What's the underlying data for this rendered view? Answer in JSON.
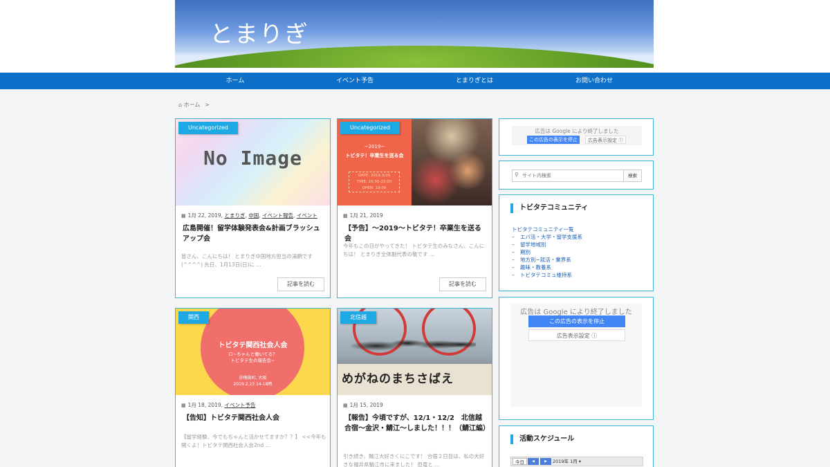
{
  "site": {
    "title": "とまりぎ"
  },
  "nav": [
    {
      "label": "ホーム"
    },
    {
      "label": "イベント予告"
    },
    {
      "label": "とまりぎとは"
    },
    {
      "label": "お問い合わせ"
    }
  ],
  "breadcrumb": {
    "home": "ホーム",
    "sep": ">"
  },
  "posts": [
    {
      "category": "Uncategorized",
      "thumb_text": "No Image",
      "date": "1月 22, 2019,",
      "tags": [
        "とまりぎ",
        "中国",
        "イベント報告",
        "イベント"
      ],
      "title": "広島開催！留学体験発表会&計画ブラッシュアップ会",
      "excerpt": "皆さん、こんにちは！ とまりぎ中国地方担当の湯網です(^^^^) 先日、1月13日(日)に …",
      "read_more": "記事を読む"
    },
    {
      "category": "Uncategorized",
      "thumb_lines": [
        "~2019~",
        "トビタテ！卒業生を送る会",
        "DATE: 2019.3/29",
        "TIME: 19:30-22:00",
        "OPEN: 19:00"
      ],
      "date": "1月 21, 2019",
      "tags": [],
      "title": "【予告】～2019～トビタテ！卒業生を送る会",
      "excerpt": "今年もこの日がやってきた！ トビタテ生のみなさん、こんにちは！ とまりぎ全体副代表の敬です …",
      "read_more": "記事を読む"
    },
    {
      "category": "関西",
      "thumb_lines": [
        "トビタテ関西社会人会",
        "ロ~ちゃんと働いてる？",
        "トビタテ生の報告会~",
        "＠梅田町, 大阪",
        "2019.2.23 14-18時"
      ],
      "date": "1月 18, 2019,",
      "tags": [
        "イベント予告"
      ],
      "title": "【告知】トビタテ関西社会人会",
      "excerpt": "【留学経験、今でもちゃんと活かせてますか？？】 <<今年も開くよ！トビタテ関西社会人会2nd …",
      "read_more": ""
    },
    {
      "category": "北信越",
      "thumb_text": "めがねのまちさばえ",
      "date": "1月 15, 2019",
      "tags": [],
      "title": "【報告】今頃ですが、12/1・12/2　北信越合宿～金沢・鯖江～しました！！！（鯖江編）",
      "excerpt": "引き続き、鯖江大好きくにこです！ 合宿２日目は、私の大好きな福井県鯖江市に来ました！ 恐竜と …",
      "read_more": ""
    }
  ],
  "sidebar": {
    "ad_small": {
      "text": "広告は Google により終了しました",
      "stop": "この広告の表示を停止",
      "settings": "広告表示設定 ⓘ"
    },
    "search": {
      "placeholder": "サイト内検索",
      "button": "検索"
    },
    "community": {
      "title": "トビタテコミュニティ",
      "root": "トビタテコミュニティ一覧",
      "items": [
        "エバ活・大学・留学支援系",
        "留学地域別",
        "期別",
        "地方別~就活・業界系",
        "趣味・教養系",
        "トビタテコミュ維持系"
      ]
    },
    "ad_big": {
      "text": "広告は Google により終了しました",
      "stop": "この広告の表示を停止",
      "settings": "広告表示設定 ⓘ"
    },
    "schedule": {
      "title": "活動スケジュール",
      "today": "今日",
      "prev": "◀",
      "next": "▶",
      "month": "2019年 1月 ▾"
    }
  }
}
